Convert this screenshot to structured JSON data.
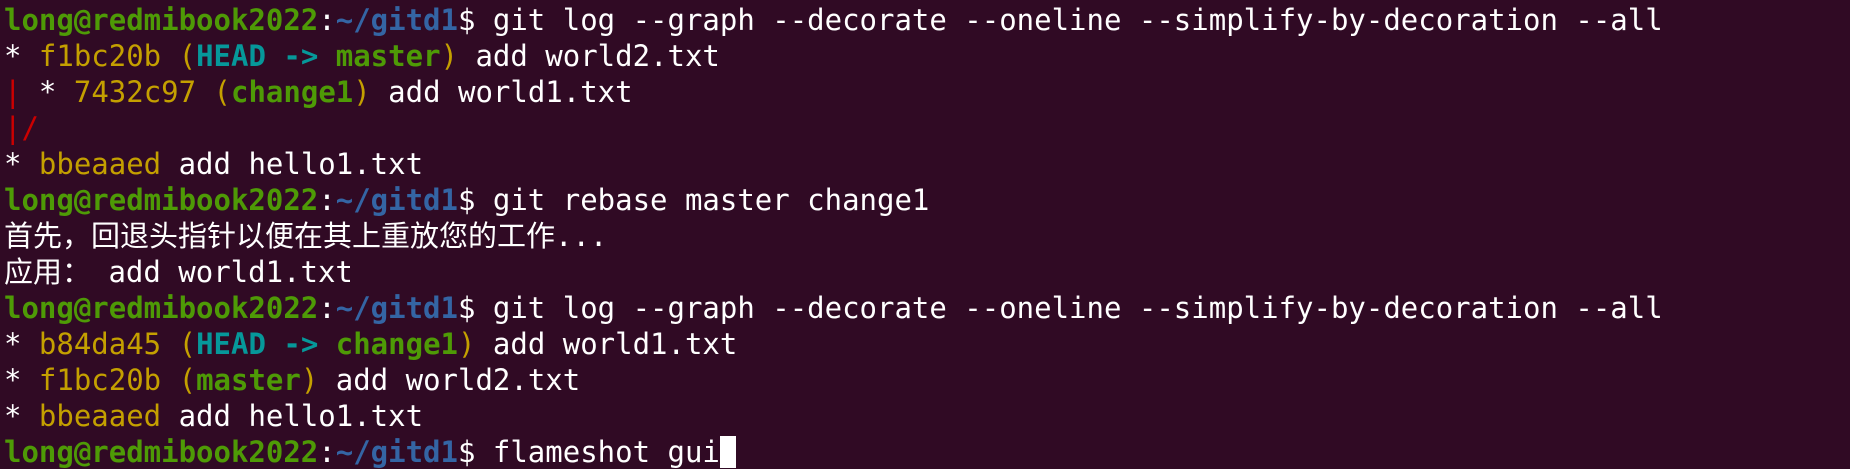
{
  "colors": {
    "background": "#300a24",
    "text": "#ffffff",
    "prompt_user": "#4e9a06",
    "prompt_path": "#3465a4",
    "hash": "#c4a000",
    "head": "#06989a",
    "branch": "#4e9a06",
    "graph_edge": "#cc0000"
  },
  "prompt": {
    "user_host": "long@redmibook2022",
    "colon": ":",
    "path": "~/gitd1",
    "symbol": "$ "
  },
  "lines": [
    {
      "type": "prompt",
      "command": "git log --graph --decorate --oneline --simplify-by-decoration --all"
    },
    {
      "type": "seg",
      "segs": [
        {
          "t": "* ",
          "c": "text"
        },
        {
          "t": "f1bc20b ",
          "c": "hash"
        },
        {
          "t": "(",
          "c": "hash"
        },
        {
          "t": "HEAD -> ",
          "c": "head",
          "b": true
        },
        {
          "t": "master",
          "c": "branch",
          "b": true
        },
        {
          "t": ")",
          "c": "hash"
        },
        {
          "t": " add world2.txt",
          "c": "text"
        }
      ]
    },
    {
      "type": "seg",
      "segs": [
        {
          "t": "|",
          "c": "graph_edge"
        },
        {
          "t": " * ",
          "c": "text"
        },
        {
          "t": "7432c97 ",
          "c": "hash"
        },
        {
          "t": "(",
          "c": "hash"
        },
        {
          "t": "change1",
          "c": "branch",
          "b": true
        },
        {
          "t": ")",
          "c": "hash"
        },
        {
          "t": " add world1.txt",
          "c": "text"
        }
      ]
    },
    {
      "type": "seg",
      "segs": [
        {
          "t": "|/",
          "c": "graph_edge"
        }
      ]
    },
    {
      "type": "seg",
      "segs": [
        {
          "t": "* ",
          "c": "text"
        },
        {
          "t": "bbeaaed",
          "c": "hash"
        },
        {
          "t": " add hello1.txt",
          "c": "text"
        }
      ]
    },
    {
      "type": "prompt",
      "command": "git rebase master change1"
    },
    {
      "type": "text",
      "text": "首先，回退头指针以便在其上重放您的工作..."
    },
    {
      "type": "text",
      "text": "应用： add world1.txt"
    },
    {
      "type": "prompt",
      "command": "git log --graph --decorate --oneline --simplify-by-decoration --all"
    },
    {
      "type": "seg",
      "segs": [
        {
          "t": "* ",
          "c": "text"
        },
        {
          "t": "b84da45 ",
          "c": "hash"
        },
        {
          "t": "(",
          "c": "hash"
        },
        {
          "t": "HEAD -> ",
          "c": "head",
          "b": true
        },
        {
          "t": "change1",
          "c": "branch",
          "b": true
        },
        {
          "t": ")",
          "c": "hash"
        },
        {
          "t": " add world1.txt",
          "c": "text"
        }
      ]
    },
    {
      "type": "seg",
      "segs": [
        {
          "t": "* ",
          "c": "text"
        },
        {
          "t": "f1bc20b ",
          "c": "hash"
        },
        {
          "t": "(",
          "c": "hash"
        },
        {
          "t": "master",
          "c": "branch",
          "b": true
        },
        {
          "t": ")",
          "c": "hash"
        },
        {
          "t": " add world2.txt",
          "c": "text"
        }
      ]
    },
    {
      "type": "seg",
      "segs": [
        {
          "t": "* ",
          "c": "text"
        },
        {
          "t": "bbeaaed",
          "c": "hash"
        },
        {
          "t": " add hello1.txt",
          "c": "text"
        }
      ]
    },
    {
      "type": "prompt",
      "command": "flameshot gui",
      "cursor": true
    }
  ]
}
